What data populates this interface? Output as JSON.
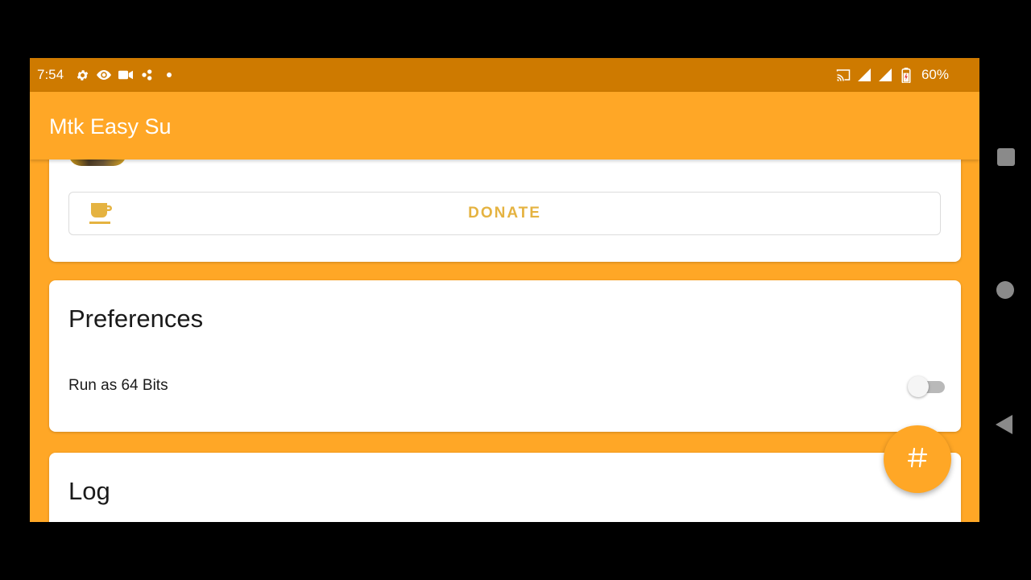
{
  "status_bar": {
    "time": "7:54",
    "left_icons": [
      "settings-icon",
      "eye-icon",
      "video-icon",
      "gamepad-icon",
      "dot-icon"
    ],
    "right_icons": [
      "cast-icon",
      "signal-icon",
      "signal-icon",
      "battery-icon"
    ],
    "battery_percent": "60%"
  },
  "app_bar": {
    "title": "Mtk Easy Su"
  },
  "donate_card": {
    "button_label": "DONATE",
    "icon": "coffee-cup-icon"
  },
  "preferences_card": {
    "title": "Preferences",
    "items": [
      {
        "label": "Run as 64 Bits",
        "enabled": false
      }
    ]
  },
  "log_card": {
    "title": "Log"
  },
  "fab": {
    "icon": "hash-icon"
  },
  "nav_bar": {
    "buttons": [
      "recent-apps-button",
      "home-button",
      "back-button"
    ]
  },
  "colors": {
    "primary": "#FFA726",
    "primary_dark": "#CE7A00",
    "accent_text": "#E5B341",
    "switch_off_track": "#B9B9B9"
  }
}
